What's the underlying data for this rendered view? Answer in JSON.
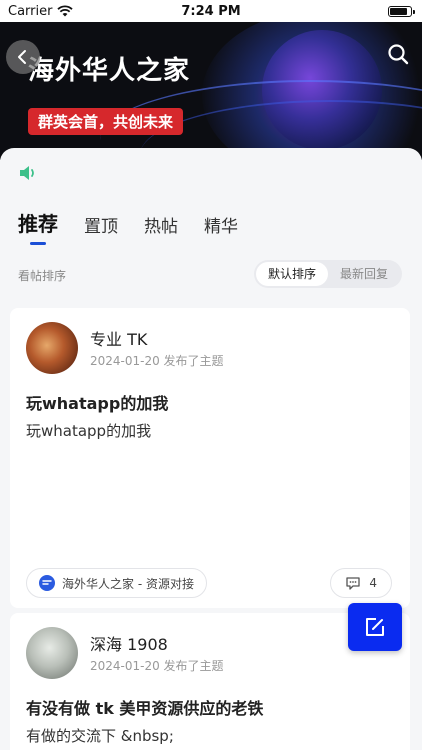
{
  "status_bar": {
    "carrier": "Carrier",
    "time": "7:24 PM",
    "battery_level": 0.85
  },
  "banner": {
    "title": "海外华人之家",
    "slogan": "群英会首，共创未来",
    "back_icon": "chevron-left-icon",
    "search_icon": "search-icon"
  },
  "tabs": [
    {
      "label": "推荐",
      "active": true
    },
    {
      "label": "置顶",
      "active": false
    },
    {
      "label": "热帖",
      "active": false
    },
    {
      "label": "精华",
      "active": false
    }
  ],
  "sort": {
    "label": "看帖排序",
    "options": [
      {
        "label": "默认排序",
        "active": true
      },
      {
        "label": "最新回复",
        "active": false
      }
    ]
  },
  "posts": [
    {
      "author": "专业 TK",
      "meta": "2024-01-20 发布了主题",
      "title": "玩whatapp的加我",
      "body": "玩whatapp的加我",
      "forum": "海外华人之家 - 资源对接",
      "comments": "4"
    },
    {
      "author": "深海 1908",
      "meta": "2024-01-20 发布了主题",
      "title": "有没有做 tk 美甲资源供应的老铁",
      "body": "有做的交流下 &nbsp;"
    }
  ],
  "colors": {
    "accent": "#1b4fd6",
    "fab": "#0a2bf0",
    "slogan_bg": "#d6282c",
    "speaker": "#3cc08a"
  }
}
